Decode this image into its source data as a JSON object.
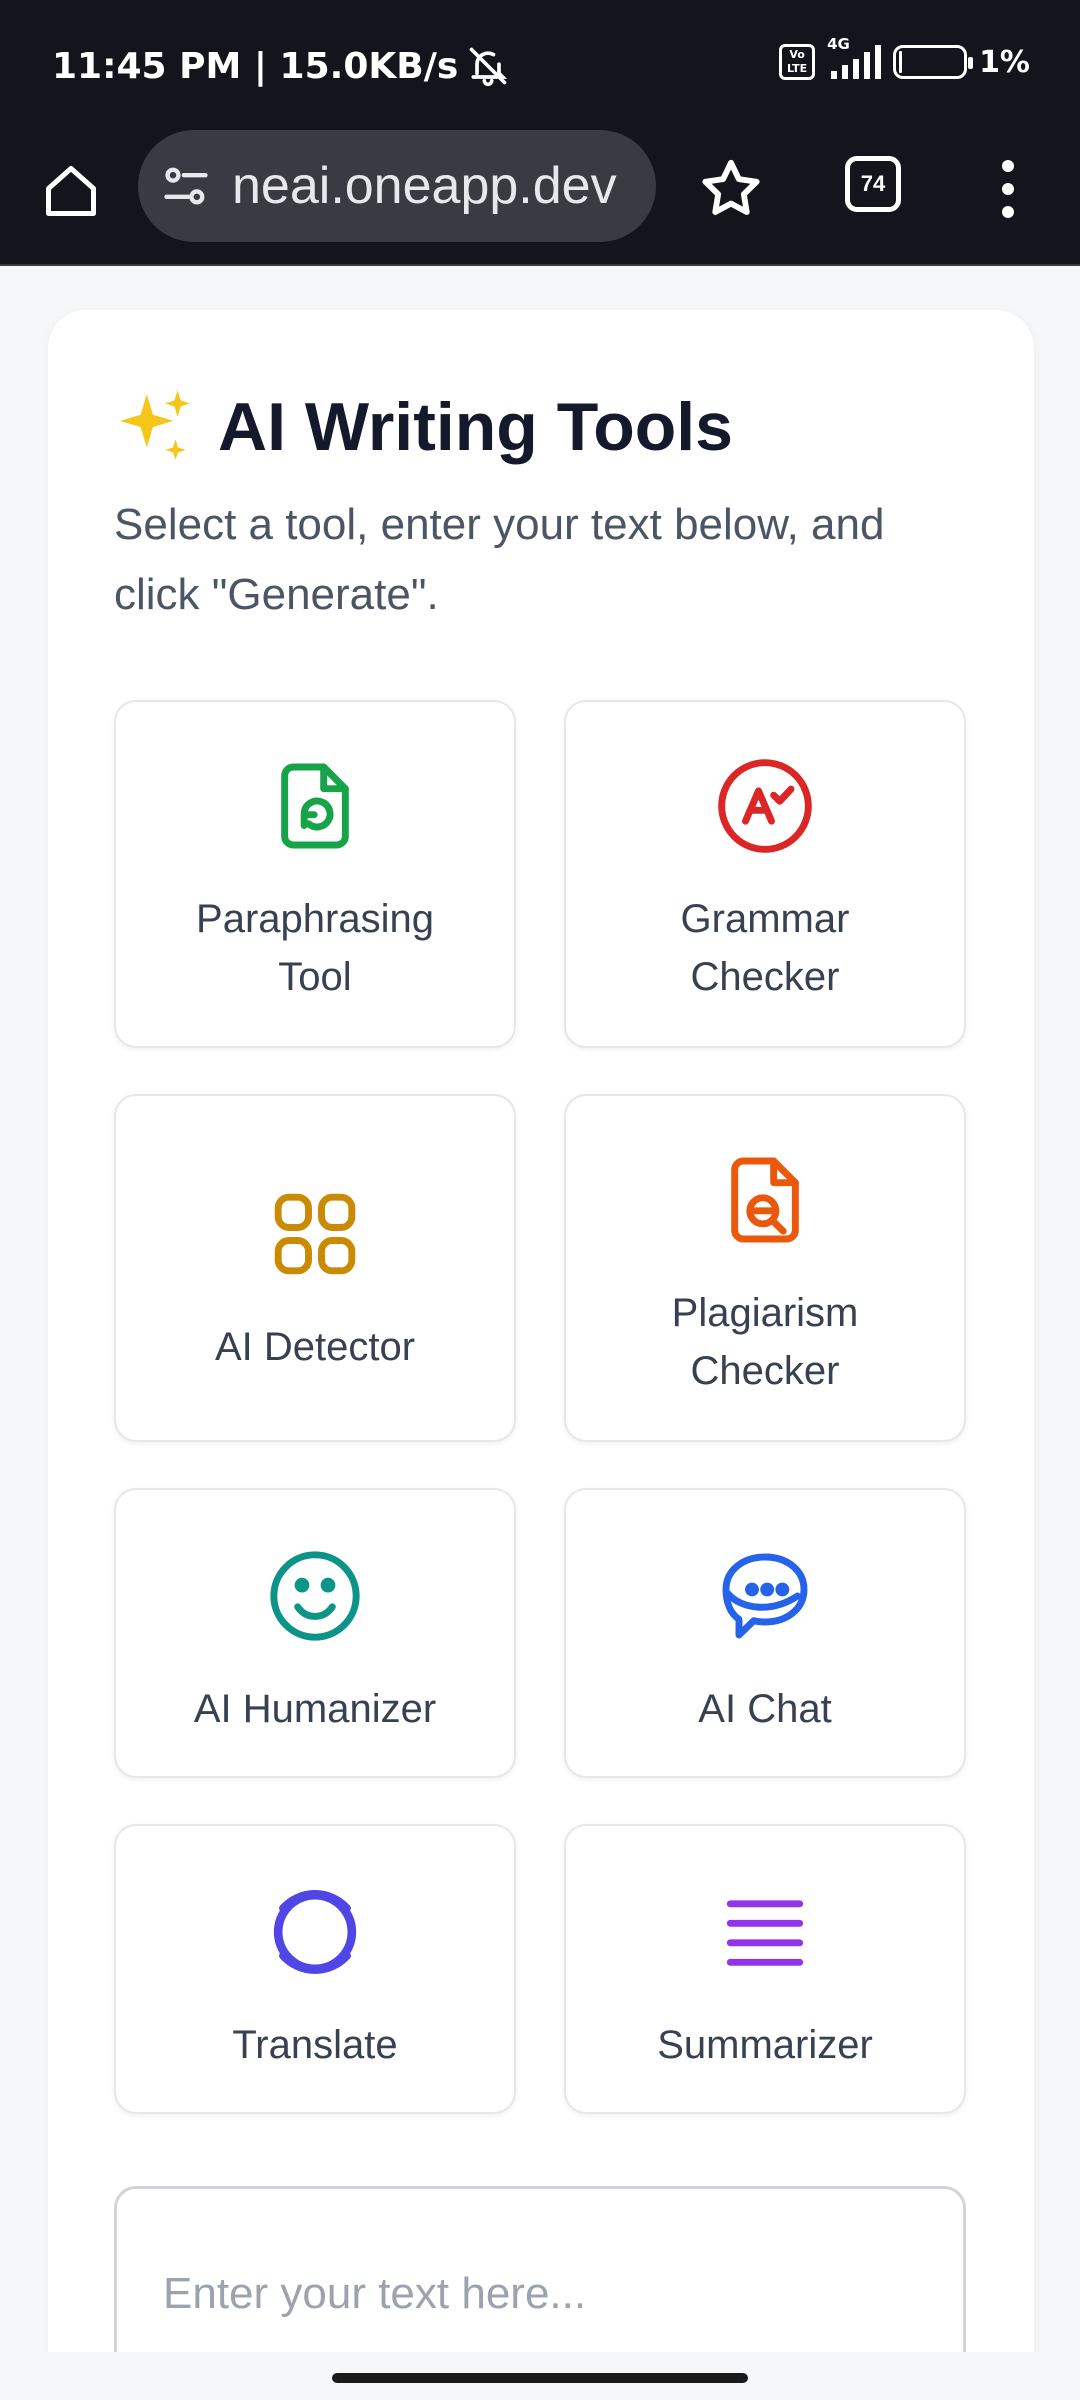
{
  "status_bar": {
    "time_speed": "11:45 PM | 15.0KB/s",
    "volte": "Vo LTE",
    "network": "4G",
    "battery": "1%"
  },
  "browser": {
    "url": "neai.oneapp.dev",
    "tab_count": "74"
  },
  "page": {
    "title": "AI Writing Tools",
    "subtitle": "Select a tool, enter your text below, and click \"Generate\".",
    "tools": [
      {
        "label": "Paraphrasing Tool",
        "icon": "file-refresh-icon",
        "color": "#16a34a"
      },
      {
        "label": "Grammar Checker",
        "icon": "grammar-check-icon",
        "color": "#dc2626"
      },
      {
        "label": "AI Detector",
        "icon": "grid-icon",
        "color": "#ca8a04"
      },
      {
        "label": "Plagiarism Checker",
        "icon": "file-search-icon",
        "color": "#ea580c"
      },
      {
        "label": "AI Humanizer",
        "icon": "smile-icon",
        "color": "#0d9488"
      },
      {
        "label": "AI Chat",
        "icon": "chat-bubble-icon",
        "color": "#2563eb"
      },
      {
        "label": "Translate",
        "icon": "ring-icon",
        "color": "#4f46e5"
      },
      {
        "label": "Summarizer",
        "icon": "lines-icon",
        "color": "#9333ea"
      }
    ],
    "input_placeholder": "Enter your text here..."
  }
}
